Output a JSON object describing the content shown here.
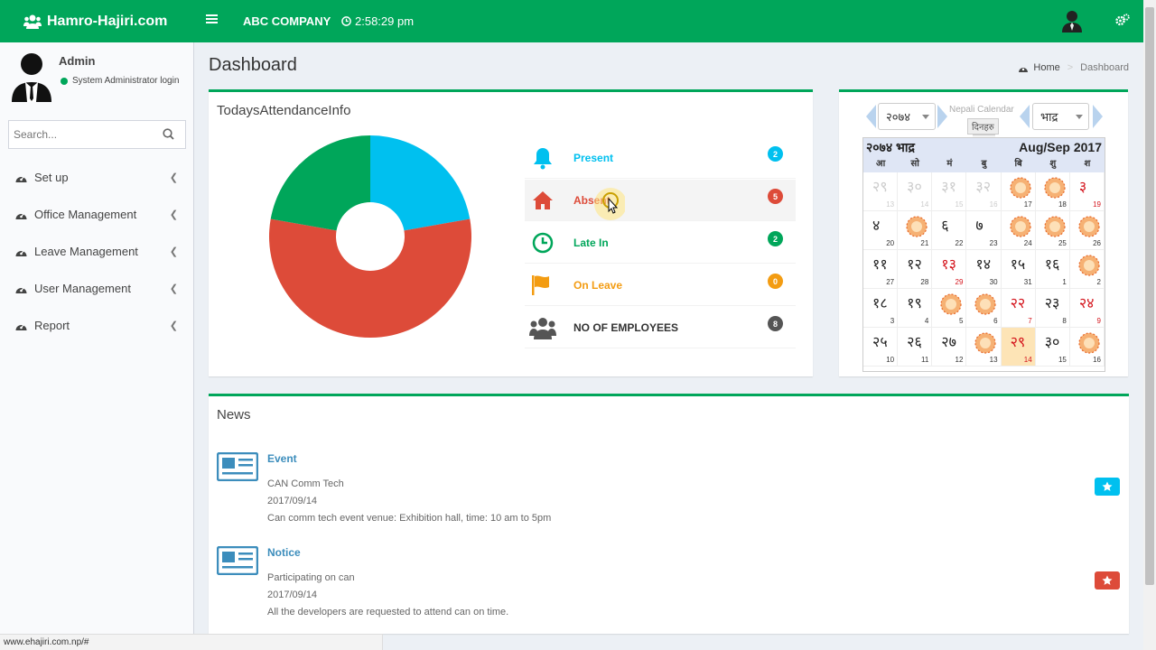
{
  "topbar": {
    "brand": "Hamro-Hajiri.com",
    "company": "ABC COMPANY",
    "time": "2:58:29 pm",
    "brand_color": "#00a65a"
  },
  "sidebar": {
    "user_name": "Admin",
    "user_status": "System Administrator login",
    "search_placeholder": "Search...",
    "items": [
      {
        "label": "Set up",
        "icon": "dashboard-icon"
      },
      {
        "label": "Office Management",
        "icon": "dashboard-icon"
      },
      {
        "label": "Leave Management",
        "icon": "dashboard-icon"
      },
      {
        "label": "User Management",
        "icon": "dashboard-icon"
      },
      {
        "label": "Report",
        "icon": "dashboard-icon"
      }
    ]
  },
  "page": {
    "title": "Dashboard",
    "breadcrumb_home": "Home",
    "breadcrumb_current": "Dashboard"
  },
  "attendance": {
    "title": "TodaysAttendanceInfo",
    "rows": [
      {
        "label": "Present",
        "count": "2",
        "color": "#00c0ef",
        "icon": "bell-icon"
      },
      {
        "label": "Absent",
        "count": "5",
        "color": "#dd4b39",
        "icon": "home-icon"
      },
      {
        "label": "Late In",
        "count": "2",
        "color": "#00a65a",
        "icon": "clock-icon"
      },
      {
        "label": "On Leave",
        "count": "0",
        "color": "#f39c12",
        "icon": "flag-icon"
      },
      {
        "label": "NO OF EMPLOYEES",
        "count": "8",
        "color": "#555555",
        "icon": "users-icon"
      }
    ]
  },
  "chart_data": {
    "type": "pie",
    "donut": true,
    "categories": [
      "Present",
      "Absent",
      "Late In",
      "On Leave"
    ],
    "values": [
      2,
      5,
      2,
      0
    ],
    "colors": [
      "#00c0ef",
      "#dd4b39",
      "#00a65a",
      "#f39c12"
    ]
  },
  "calendar": {
    "title_label": "Nepali Calendar",
    "today_button": "दिनहरु",
    "year_select": "२०७४",
    "month_select": "भाद्र",
    "header_left": "२०७४ भाद्र",
    "header_right": "Aug/Sep 2017",
    "weekdays": [
      "आ",
      "सो",
      "मं",
      "बु",
      "बि",
      "शु",
      "श"
    ],
    "rows": [
      [
        {
          "np": "२९",
          "en": "13",
          "type": "dim"
        },
        {
          "np": "३०",
          "en": "14",
          "type": "dim"
        },
        {
          "np": "३१",
          "en": "15",
          "type": "dim"
        },
        {
          "np": "३२",
          "en": "16",
          "type": "dim"
        },
        {
          "np": "१",
          "en": "17",
          "type": "fest"
        },
        {
          "np": "२",
          "en": "18",
          "type": "fest"
        },
        {
          "np": "३",
          "en": "19",
          "type": "hol"
        }
      ],
      [
        {
          "np": "४",
          "en": "20",
          "type": ""
        },
        {
          "np": "५",
          "en": "21",
          "type": "fest"
        },
        {
          "np": "६",
          "en": "22",
          "type": ""
        },
        {
          "np": "७",
          "en": "23",
          "type": ""
        },
        {
          "np": "८",
          "en": "24",
          "type": "fest"
        },
        {
          "np": "९",
          "en": "25",
          "type": "fest"
        },
        {
          "np": "१०",
          "en": "26",
          "type": "fest"
        }
      ],
      [
        {
          "np": "११",
          "en": "27",
          "type": ""
        },
        {
          "np": "१२",
          "en": "28",
          "type": ""
        },
        {
          "np": "१३",
          "en": "29",
          "type": "hol"
        },
        {
          "np": "१४",
          "en": "30",
          "type": ""
        },
        {
          "np": "१५",
          "en": "31",
          "type": ""
        },
        {
          "np": "१६",
          "en": "1",
          "type": ""
        },
        {
          "np": "१७",
          "en": "2",
          "type": "fest"
        }
      ],
      [
        {
          "np": "१८",
          "en": "3",
          "type": ""
        },
        {
          "np": "१९",
          "en": "4",
          "type": ""
        },
        {
          "np": "२०",
          "en": "5",
          "type": "fest"
        },
        {
          "np": "२१",
          "en": "6",
          "type": "fest"
        },
        {
          "np": "२२",
          "en": "7",
          "type": "hol"
        },
        {
          "np": "२३",
          "en": "8",
          "type": ""
        },
        {
          "np": "२४",
          "en": "9",
          "type": "hol"
        }
      ],
      [
        {
          "np": "२५",
          "en": "10",
          "type": ""
        },
        {
          "np": "२६",
          "en": "11",
          "type": ""
        },
        {
          "np": "२७",
          "en": "12",
          "type": ""
        },
        {
          "np": "२८",
          "en": "13",
          "type": "fest"
        },
        {
          "np": "२९",
          "en": "14",
          "type": "today"
        },
        {
          "np": "३०",
          "en": "15",
          "type": ""
        },
        {
          "np": "३१",
          "en": "16",
          "type": "fest"
        }
      ]
    ]
  },
  "news": {
    "title": "News",
    "items": [
      {
        "title": "Event",
        "org": "CAN Comm Tech",
        "date": "2017/09/14",
        "desc": "Can comm tech event venue: Exhibition hall, time: 10 am to 5pm",
        "star_color": "#00c0ef"
      },
      {
        "title": "Notice",
        "org": "Participating on can",
        "date": "2017/09/14",
        "desc": "All the developers are requested to attend can on time.",
        "star_color": "#dd4b39"
      }
    ]
  },
  "statusbar": {
    "url": "www.ehajiri.com.np/#"
  }
}
